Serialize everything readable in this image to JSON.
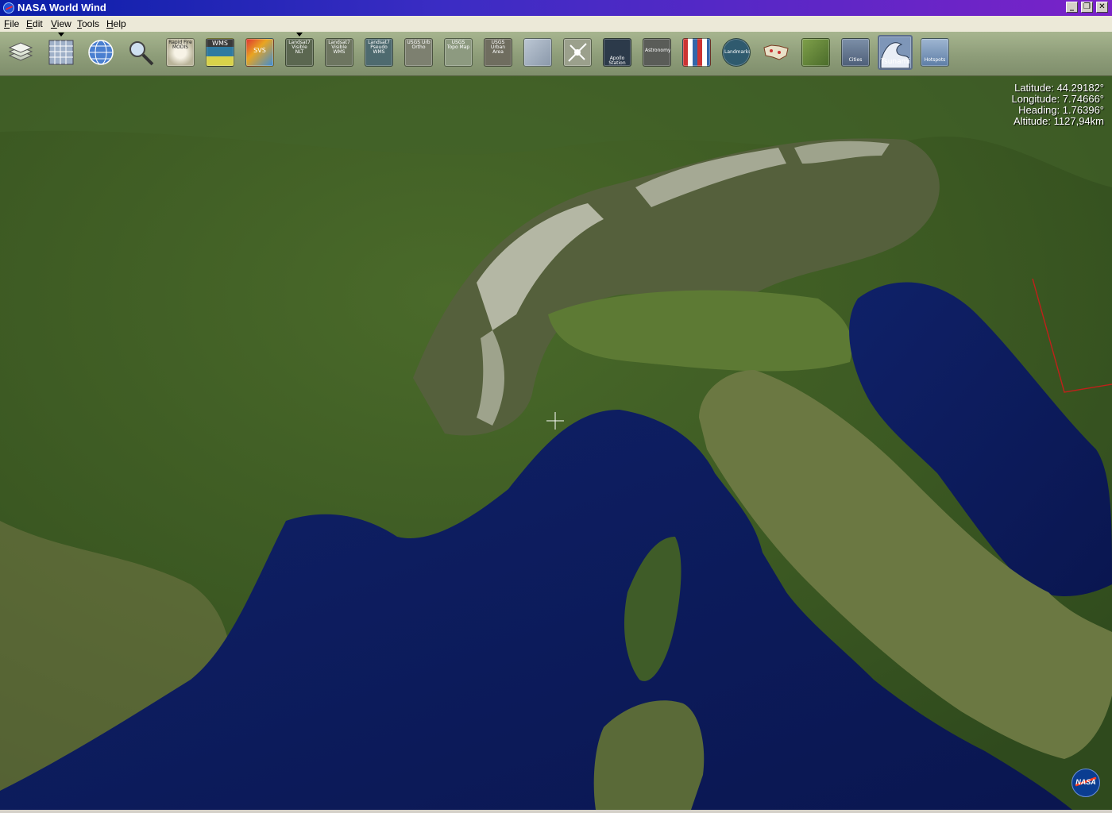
{
  "window": {
    "title": "NASA World Wind",
    "minimize_glyph": "_",
    "restore_glyph": "❐",
    "close_glyph": "✕"
  },
  "menu": {
    "items": [
      {
        "accel": "F",
        "rest": "ile"
      },
      {
        "accel": "E",
        "rest": "dit"
      },
      {
        "accel": "V",
        "rest": "iew"
      },
      {
        "accel": "T",
        "rest": "ools"
      },
      {
        "accel": "H",
        "rest": "elp"
      }
    ]
  },
  "toolbar": {
    "buttons": [
      {
        "name": "layer-manager",
        "caption": ""
      },
      {
        "name": "lat-lon-grid",
        "caption": ""
      },
      {
        "name": "globe",
        "caption": ""
      },
      {
        "name": "place-finder",
        "caption": ""
      },
      {
        "name": "rapid-fire-modis",
        "caption": "Rapid Fire MODIS"
      },
      {
        "name": "wms-browser",
        "caption": "WMS"
      },
      {
        "name": "scientific-visualization",
        "caption": "SVS"
      },
      {
        "name": "landsat7-visible-nlt",
        "caption": "Landsat7 Visible NLT"
      },
      {
        "name": "landsat7-visible-wms",
        "caption": "Landsat7 Visible WMS"
      },
      {
        "name": "landsat7-pseudo-wms",
        "caption": "Landsat7 Pseudo WMS"
      },
      {
        "name": "usgs-urban-ortho",
        "caption": "USGS Urb Ortho"
      },
      {
        "name": "usgs-topo-map",
        "caption": "USGS Topo Map"
      },
      {
        "name": "usgs-urban-area",
        "caption": "USGS Urban Area"
      },
      {
        "name": "blue-marble",
        "caption": ""
      },
      {
        "name": "placenames",
        "caption": ""
      },
      {
        "name": "apollo-station",
        "caption": "Apollo Station"
      },
      {
        "name": "astronomy",
        "caption": "Astronomy"
      },
      {
        "name": "country-flags",
        "caption": ""
      },
      {
        "name": "landmarks",
        "caption": "Landmarks"
      },
      {
        "name": "usa-map",
        "caption": ""
      },
      {
        "name": "terrain-model",
        "caption": ""
      },
      {
        "name": "cities",
        "caption": "Cities"
      },
      {
        "name": "tsunami",
        "caption": "Tsunami"
      },
      {
        "name": "hotspots",
        "caption": "Hotspots"
      }
    ]
  },
  "readout": {
    "latitude": "Latitude: 44.29182°",
    "longitude": "Longitude: 7.74666°",
    "heading": "Heading: 1.76396°",
    "altitude": "Altitude: 1127,94km"
  },
  "nasa_logo_text": "NASA",
  "colors": {
    "sea": "#0b1a5a",
    "land": "#3d5a24",
    "alps": "#5a6040",
    "snow": "#e8e6dc",
    "boundary": "#c0201a"
  }
}
